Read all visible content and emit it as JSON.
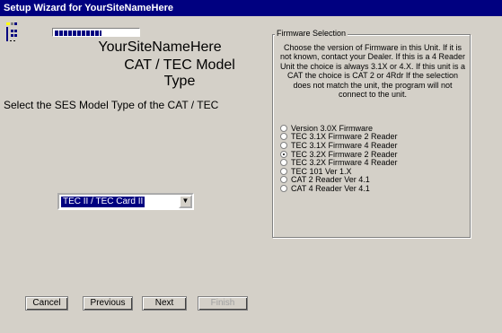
{
  "window": {
    "title": "Setup Wizard for YourSiteNameHere"
  },
  "progress": {
    "fraction": 0.55
  },
  "header": {
    "site_name": "YourSiteNameHere",
    "page_title": "CAT / TEC Model Type"
  },
  "prompt": "Select the SES Model Type of the CAT / TEC",
  "model_select": {
    "value": "TEC II / TEC Card II"
  },
  "firmware": {
    "legend": "Firmware Selection",
    "description": "Choose the version of Firmware in this Unit. If it is not known, contact your Dealer. If this is a 4 Reader Unit the choice is always 3.1X or 4.X. If this unit is a CAT the choice is CAT 2 or 4Rdr If the selection does not match the unit, the program will not connect to the unit.",
    "options": [
      {
        "label": "Version 3.0X Firmware",
        "checked": false
      },
      {
        "label": "TEC 3.1X Firmware 2 Reader",
        "checked": false
      },
      {
        "label": "TEC 3.1X Firmware 4 Reader",
        "checked": false
      },
      {
        "label": "TEC 3.2X Firmware 2 Reader",
        "checked": true
      },
      {
        "label": "TEC 3.2X Firmware 4 Reader",
        "checked": false
      },
      {
        "label": "TEC 101 Ver 1.X",
        "checked": false
      },
      {
        "label": "CAT 2 Reader Ver 4.1",
        "checked": false
      },
      {
        "label": "CAT 4 Reader Ver 4.1",
        "checked": false
      }
    ]
  },
  "buttons": {
    "cancel": "Cancel",
    "previous": "Previous",
    "next": "Next",
    "finish": "Finish"
  }
}
